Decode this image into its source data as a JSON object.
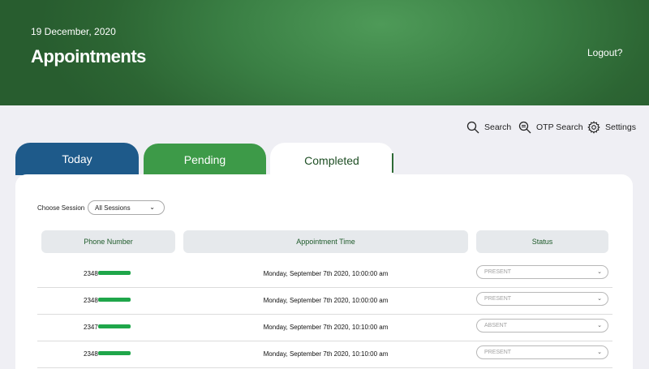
{
  "header": {
    "date": "19 December, 2020",
    "title": "Appointments",
    "logout_label": "Logout?"
  },
  "toolbar": {
    "search_label": "Search",
    "otp_search_label": "OTP Search",
    "settings_label": "Settings"
  },
  "tabs": [
    {
      "label": "Today"
    },
    {
      "label": "Pending"
    },
    {
      "label": "Completed"
    }
  ],
  "session": {
    "label": "Choose Session",
    "selected": "All Sessions"
  },
  "table": {
    "columns": [
      "Phone Number",
      "Appointment Time",
      "Status"
    ],
    "rows": [
      {
        "phone_prefix": "2348",
        "time": "Monday, September 7th 2020, 10:00:00 am",
        "status": "PRESENT"
      },
      {
        "phone_prefix": "2348",
        "time": "Monday, September 7th 2020, 10:00:00 am",
        "status": "PRESENT"
      },
      {
        "phone_prefix": "2347",
        "time": "Monday, September 7th 2020, 10:10:00 am",
        "status": "ABSENT"
      },
      {
        "phone_prefix": "2348",
        "time": "Monday, September 7th 2020, 10:10:00 am",
        "status": "PRESENT"
      }
    ]
  },
  "colors": {
    "header_green": "#3a7f44",
    "tab_today": "#1e5a8a",
    "tab_pending": "#3d9a48",
    "accent_text": "#1e5a2a",
    "phone_mask": "#1fa64a"
  }
}
